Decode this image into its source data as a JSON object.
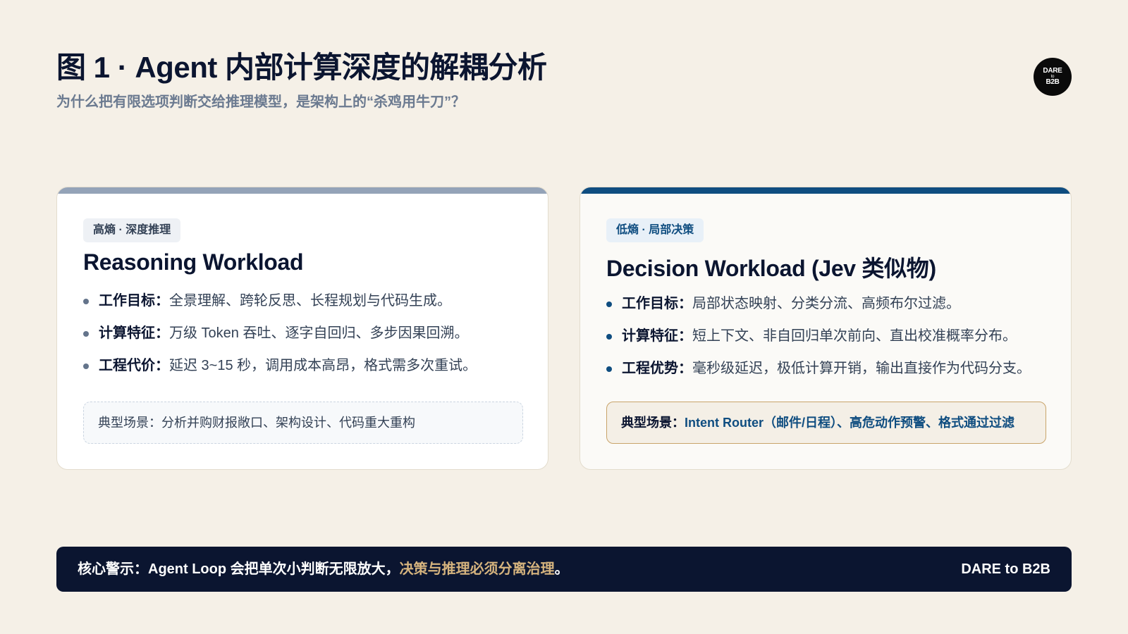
{
  "header": {
    "title": "图 1 · Agent 内部计算深度的解耦分析",
    "subtitle": "为什么把有限选项判断交给推理模型，是架构上的“杀鸡用牛刀”？",
    "logo_line1": "DARE",
    "logo_line2": "to",
    "logo_line3": "B2B"
  },
  "cards": {
    "reasoning": {
      "tag": "高熵 · 深度推理",
      "title": "Reasoning Workload",
      "bullets": [
        {
          "label": "工作目标：",
          "text": "全景理解、跨轮反思、长程规划与代码生成。"
        },
        {
          "label": "计算特征：",
          "text": "万级 Token 吞吐、逐字自回归、多步因果回溯。"
        },
        {
          "label": "工程代价：",
          "text": "延迟 3~15 秒，调用成本高昂，格式需多次重试。"
        }
      ],
      "scene": "典型场景：分析并购财报敞口、架构设计、代码重大重构"
    },
    "decision": {
      "tag": "低熵 · 局部决策",
      "title": "Decision Workload (Jev 类似物)",
      "bullets": [
        {
          "label": "工作目标：",
          "text": "局部状态映射、分类分流、高频布尔过滤。"
        },
        {
          "label": "计算特征：",
          "text": "短上下文、非自回归单次前向、直出校准概率分布。"
        },
        {
          "label": "工程优势：",
          "text": "毫秒级延迟，极低计算开销，输出直接作为代码分支。"
        }
      ],
      "scene_label": "典型场景：",
      "scene_text": "Intent Router（邮件/日程）、高危动作预警、格式通过过滤"
    }
  },
  "footer": {
    "prefix": "核心警示：Agent Loop 会把单次小判断无限放大，",
    "highlight": "决策与推理必须分离治理",
    "suffix": "。",
    "brand": "DARE to B2B"
  },
  "colors": {
    "background": "#f5f0e7",
    "navy": "#0b1530",
    "accent_blue": "#0f4d80",
    "accent_gold": "#d6b47e",
    "slate_bar": "#94a3b8"
  }
}
